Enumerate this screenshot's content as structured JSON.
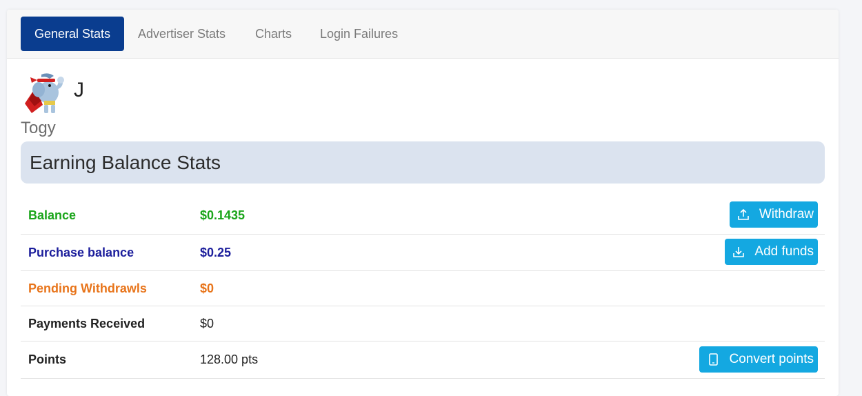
{
  "tabs": [
    {
      "label": "General Stats",
      "active": true
    },
    {
      "label": "Advertiser Stats"
    },
    {
      "label": "Charts"
    },
    {
      "label": "Login Failures"
    }
  ],
  "user": {
    "name": "J",
    "subtitle": "Togy",
    "avatar_icon": "superhero-elephant-mascot"
  },
  "section": {
    "title": "Earning Balance Stats"
  },
  "stats": [
    {
      "label": "Balance",
      "value": "$0.1435",
      "color": "#1aa51a",
      "button": {
        "label": "Withdraw",
        "icon": "upload-icon"
      }
    },
    {
      "label": "Purchase balance",
      "value": "$0.25",
      "color": "#1c1e9c",
      "button": {
        "label": "Add funds",
        "icon": "download-icon"
      }
    },
    {
      "label": "Pending Withdrawls",
      "value": "$0",
      "color": "#e8741a"
    },
    {
      "label": "Payments Received",
      "value": "$0",
      "color": "#222222"
    },
    {
      "label": "Points",
      "value": "128.00 pts",
      "color": "#222222",
      "button": {
        "label": "Convert points",
        "icon": "tablet-icon"
      }
    }
  ],
  "colors": {
    "accent": "#0a3d8f",
    "button": "#14a8e1",
    "section_bg": "#dbe3ef"
  }
}
